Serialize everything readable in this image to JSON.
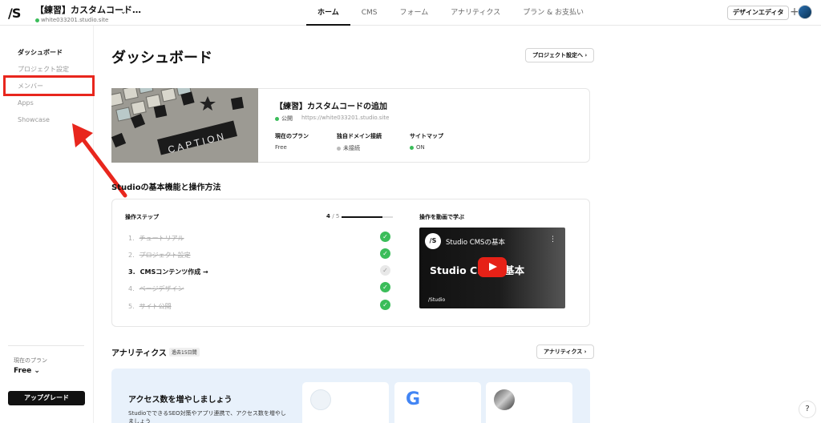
{
  "header": {
    "logo": "/S",
    "project_name": "【練習】カスタムコード…",
    "project_domain": "white033201.studio.site",
    "nav": [
      {
        "label": "ホーム",
        "active": true
      },
      {
        "label": "CMS",
        "active": false
      },
      {
        "label": "フォーム",
        "active": false
      },
      {
        "label": "アナリティクス",
        "active": false
      },
      {
        "label": "プラン & お支払い",
        "active": false
      }
    ],
    "design_editor_label": "デザインエディタ",
    "plus_label": "+"
  },
  "sidebar": {
    "items": [
      {
        "label": "ダッシュボード",
        "active": true
      },
      {
        "label": "プロジェクト設定",
        "active": false
      },
      {
        "label": "メンバー",
        "active": false
      },
      {
        "label": "Apps",
        "active": false
      },
      {
        "label": "Showcase",
        "active": false
      }
    ],
    "plan_label": "現在のプラン",
    "plan_value": "Free ⌄",
    "upgrade_label": "アップグレード"
  },
  "dashboard": {
    "title": "ダッシュボード",
    "project_settings_button": "プロジェクト設定へ ›",
    "project": {
      "title": "【練習】カスタムコードの追加",
      "status": "公開",
      "url": "https://white033201.studio.site",
      "meta": [
        {
          "label": "現在のプラン",
          "value": "Free"
        },
        {
          "label": "独自ドメイン接続",
          "value": "未接続"
        },
        {
          "label": "サイトマップ",
          "value": "ON"
        }
      ]
    }
  },
  "basics": {
    "title": "Studioの基本機能と操作方法",
    "steps_label": "操作ステップ",
    "progress_done": "4",
    "progress_total": "/ 5",
    "progress_fraction": 0.8,
    "steps": [
      {
        "number": "1.",
        "label": "チュートリアル",
        "done": true
      },
      {
        "number": "2.",
        "label": "プロジェクト設定",
        "done": true
      },
      {
        "number": "3.",
        "label": "CMSコンテンツ作成 →",
        "done": false
      },
      {
        "number": "4.",
        "label": "ページデザイン",
        "done": true
      },
      {
        "number": "5.",
        "label": "サイト公開",
        "done": true
      }
    ],
    "video_label": "操作を動画で学ぶ",
    "video": {
      "logo": "/S",
      "title": "Studio CMSの基本",
      "overlay_text": "Studio CMSの基本",
      "brand": "/Studio"
    }
  },
  "analytics": {
    "title": "アナリティクス",
    "period_badge": "過去15日間",
    "button_label": "アナリティクス ›",
    "panel_title": "アクセス数を増やしましょう",
    "panel_desc": "StudioでできるSEO対策やアプリ連携で、アクセス数を増やしましょう",
    "google_letter": "G"
  },
  "help_label": "?",
  "colors": {
    "accent_red": "#e8261d",
    "success_green": "#3bbd5a",
    "panel_blue": "#e8f1fb"
  }
}
